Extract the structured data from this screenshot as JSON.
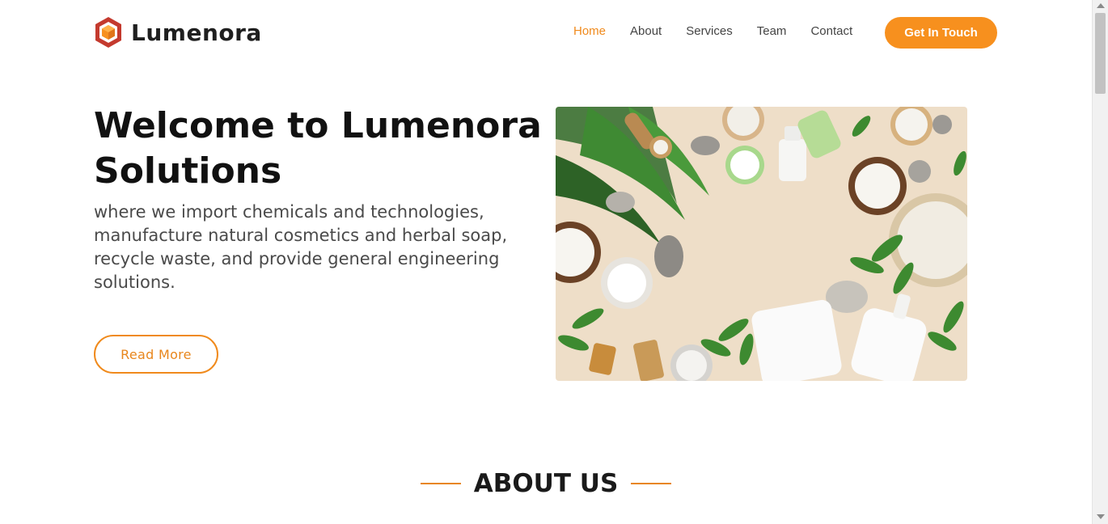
{
  "brand": {
    "name": "Lumenora",
    "logo_icon": "hexagon-cube-logo",
    "colors": {
      "outer": "#c43a2e",
      "inner": "#f7901e"
    }
  },
  "nav": {
    "items": [
      {
        "label": "Home",
        "active": true
      },
      {
        "label": "About",
        "active": false
      },
      {
        "label": "Services",
        "active": false
      },
      {
        "label": "Team",
        "active": false
      },
      {
        "label": "Contact",
        "active": false
      }
    ],
    "cta_label": "Get In Touch"
  },
  "hero": {
    "title": "Welcome to Lumenora Solutions",
    "subtitle": "where we import chemicals and technologies, manufacture natural cosmetics and herbal soap, recycle waste, and provide general engineering solutions.",
    "button_label": "Read More",
    "image_subject": "natural-cosmetics-flatlay"
  },
  "about": {
    "heading": "ABOUT US"
  },
  "theme": {
    "accent": "#f7901e",
    "text_dark": "#111111",
    "text_muted": "#4a4a4a",
    "hero_image_bg": "#eedec8"
  }
}
